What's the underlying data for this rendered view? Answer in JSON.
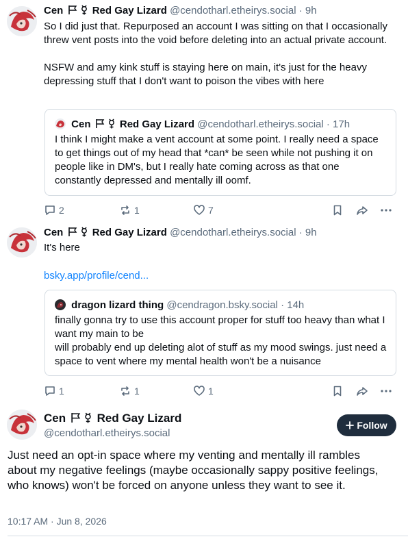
{
  "thread": [
    {
      "display_name": "Cen",
      "name_suffix": "Red Gay Lizard",
      "handle": "@cendotharl.etheirys.social",
      "time": "· 9h",
      "text_p1": "So I did just that. Repurposed an account I was sitting on that I occasionally threw vent posts into the void before deleting into an actual private account.",
      "text_p2": "NSFW and amy kink stuff is staying here on main, it's just for the heavy depressing stuff that I don't want to poison the vibes with here",
      "quote": {
        "display_name": "Cen",
        "name_suffix": "Red Gay Lizard",
        "handle": "@cendotharl.etheirys.social",
        "time": "· 17h",
        "text": "I think I might make a vent account at some point. I really need a space to get things out of my head that *can* be seen while not pushing it on people like in DM's, but I really hate coming across as that one constantly depressed and mentally ill oomf."
      },
      "replies": "2",
      "reposts": "1",
      "likes": "7"
    },
    {
      "display_name": "Cen",
      "name_suffix": "Red Gay Lizard",
      "handle": "@cendotharl.etheirys.social",
      "time": "· 9h",
      "text": "It's here",
      "link": "bsky.app/profile/cend...",
      "quote": {
        "display_name": "dragon lizard thing",
        "handle": "@cendragon.bsky.social",
        "time": "· 14h",
        "line1": "finally gonna try to use this account proper for stuff too heavy than what I want my main to be",
        "line2": "will probably end up deleting alot of stuff as my mood swings. just need a space to vent where my mental health won't be a nuisance"
      },
      "replies": "1",
      "reposts": "1",
      "likes": "1"
    }
  ],
  "main_post": {
    "display_name": "Cen",
    "name_suffix": "Red Gay Lizard",
    "handle": "@cendotharl.etheirys.social",
    "follow_label": "Follow",
    "text": "Just need an opt-in space where my venting and mentally ill rambles about my negative feelings (maybe occasionally sappy positive feelings, who knows) won't be forced on anyone unless they want to see it.",
    "timestamp": "10:17 AM · Jun 8, 2026"
  },
  "colors": {
    "accent_link": "#1083fe",
    "muted": "#5b6b7c",
    "border": "#d4dbe2",
    "follow_bg": "#1f2d3d"
  }
}
